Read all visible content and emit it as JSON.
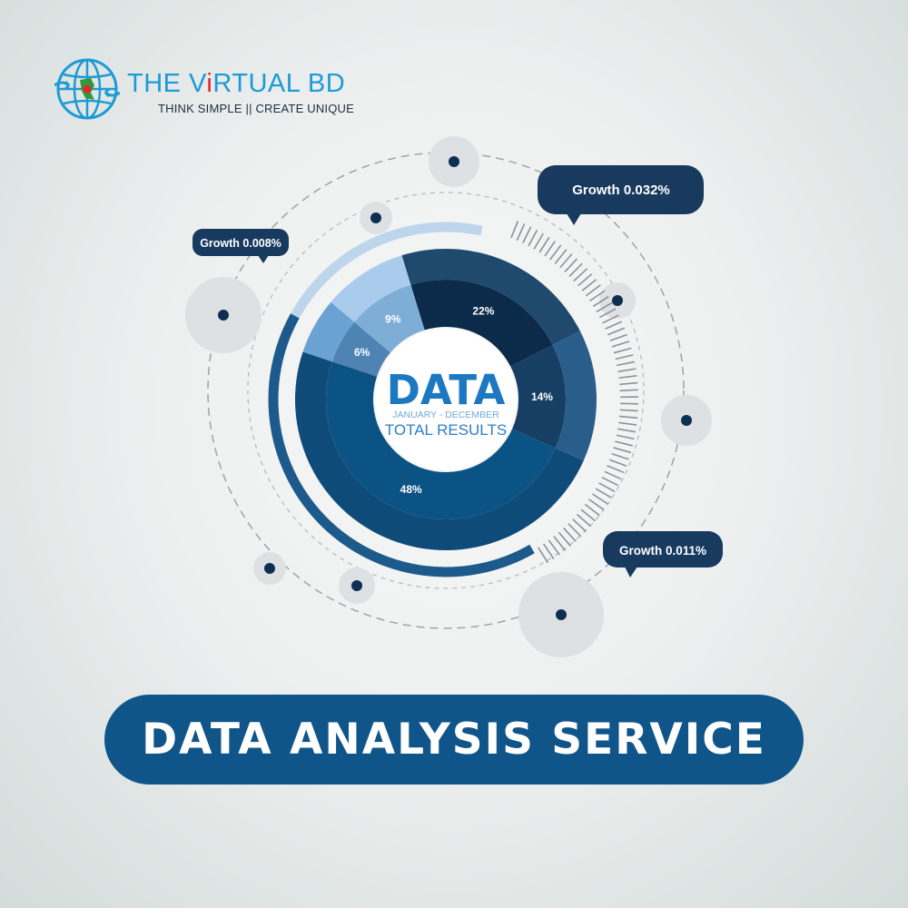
{
  "brand": {
    "name_prefix": "THE V",
    "name_accent": "i",
    "name_suffix": "RTUAL BD",
    "tagline": "THINK SIMPLE || CREATE UNIQUE"
  },
  "colors": {
    "background": "#eef0f0",
    "banner": "#105589",
    "callout": "#173a5e",
    "brand_blue": "#1e9ad6",
    "brand_red": "#e4262b"
  },
  "chart_data": {
    "type": "pie",
    "center_title": "DATA",
    "center_subtitle": "JANUARY - DECEMBER",
    "center_caption": "TOTAL RESULTS",
    "slices": [
      {
        "label": "22%",
        "value": 22,
        "outer_color": "#1f4a6d",
        "inner_color": "#0c2a49"
      },
      {
        "label": "14%",
        "value": 14,
        "outer_color": "#295e8b",
        "inner_color": "#173f64"
      },
      {
        "label": "48%",
        "value": 48,
        "outer_color": "#0f4b78",
        "inner_color": "#0c5385"
      },
      {
        "label": "6%",
        "value": 6,
        "outer_color": "#6aa3d3",
        "inner_color": "#4f83b4"
      },
      {
        "label": "9%",
        "value": 9,
        "outer_color": "#a9cbec",
        "inner_color": "#7eadd6"
      }
    ],
    "annotations": [
      {
        "text": "Growth 0.008%"
      },
      {
        "text": "Growth 0.032%"
      },
      {
        "text": "Growth 0.011%"
      }
    ]
  },
  "banner": {
    "title": "DATA ANALYSIS SERVICE"
  }
}
